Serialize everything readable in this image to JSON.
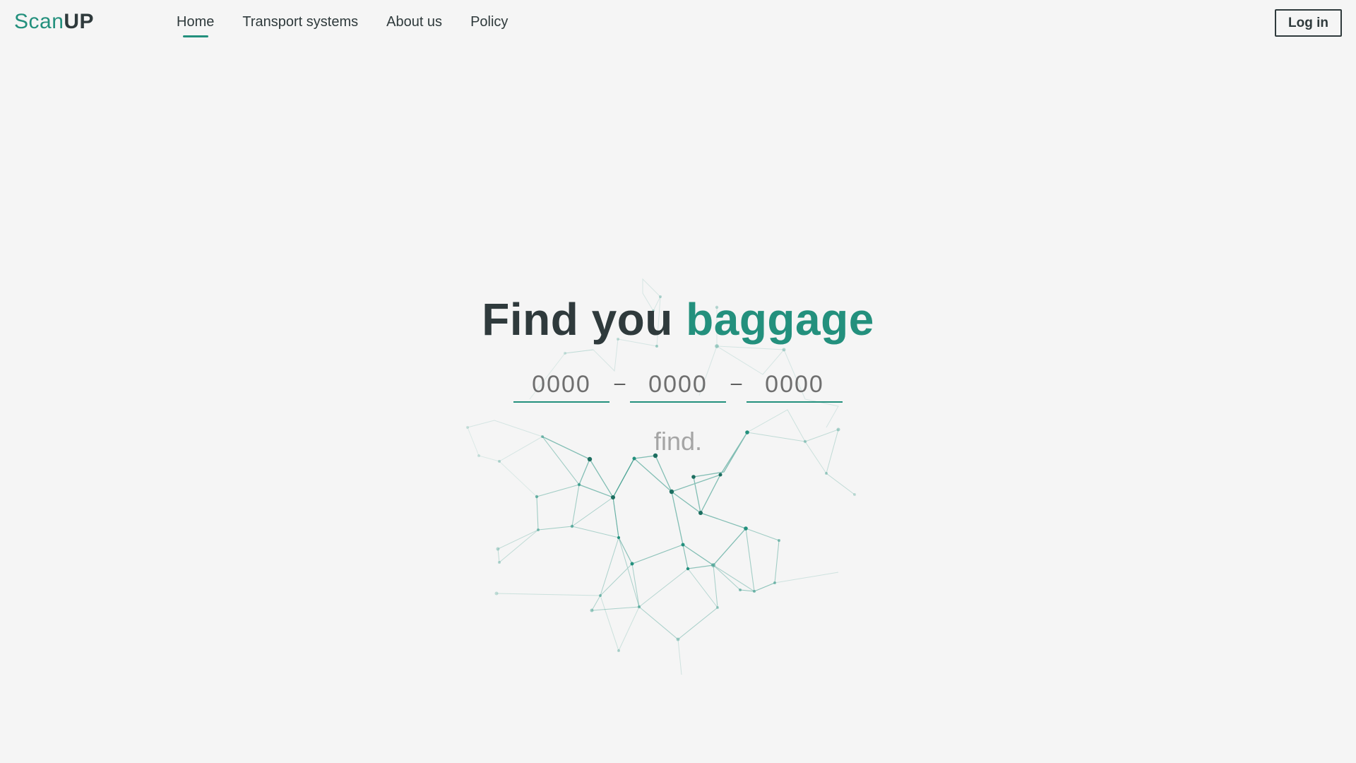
{
  "brand": {
    "part1": "Scan",
    "part2": "UP"
  },
  "nav": {
    "items": [
      {
        "label": "Home",
        "active": true
      },
      {
        "label": "Transport systems",
        "active": false
      },
      {
        "label": "About us",
        "active": false
      },
      {
        "label": "Policy",
        "active": false
      }
    ]
  },
  "header": {
    "login_label": "Log in"
  },
  "hero": {
    "title_dark": "Find you",
    "title_accent": "baggage",
    "code_placeholders": [
      "0000",
      "0000",
      "0000"
    ],
    "separator": "–",
    "find_label": "find."
  },
  "colors": {
    "accent": "#23907d",
    "text_dark": "#2f3a3c",
    "background": "#f5f5f5",
    "muted": "#a5a5a5"
  }
}
